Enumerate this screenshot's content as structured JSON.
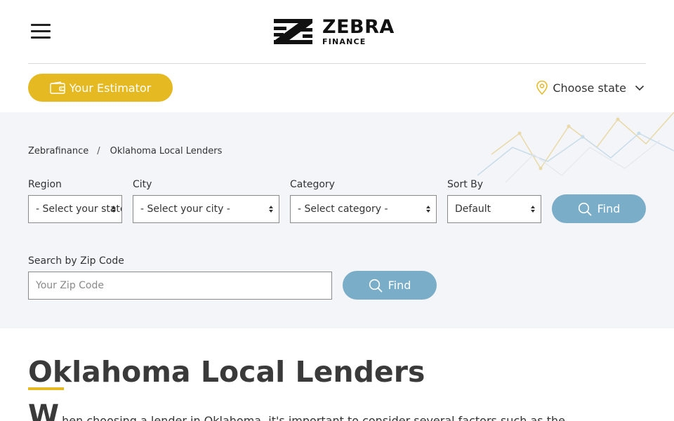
{
  "header": {
    "logo_title": "ZEBRA",
    "logo_subtitle": "FINANCE",
    "estimator_label": "Your Estimator",
    "state_label": "Choose state"
  },
  "breadcrumb": {
    "home": "Zebrafinance",
    "separator": "/",
    "current": "Oklahoma Local Lenders"
  },
  "filters": {
    "region_label": "Region",
    "region_value": "- Select your state -",
    "city_label": "City",
    "city_value": "- Select your city -",
    "category_label": "Category",
    "category_value": "- Select category -",
    "sort_label": "Sort By",
    "sort_value": "Default",
    "find_label": "Find"
  },
  "zip": {
    "label": "Search by Zip Code",
    "placeholder": "Your Zip Code",
    "find_label": "Find"
  },
  "main": {
    "title": "Oklahoma Local Lenders",
    "intro_dropcap": "W",
    "intro_text": "hen choosing a lender in Oklahoma, it's important to consider several factors such as the"
  },
  "colors": {
    "accent_yellow": "#e5b922",
    "button_blue": "#7aadc8",
    "search_bg": "#f3f5f8"
  }
}
